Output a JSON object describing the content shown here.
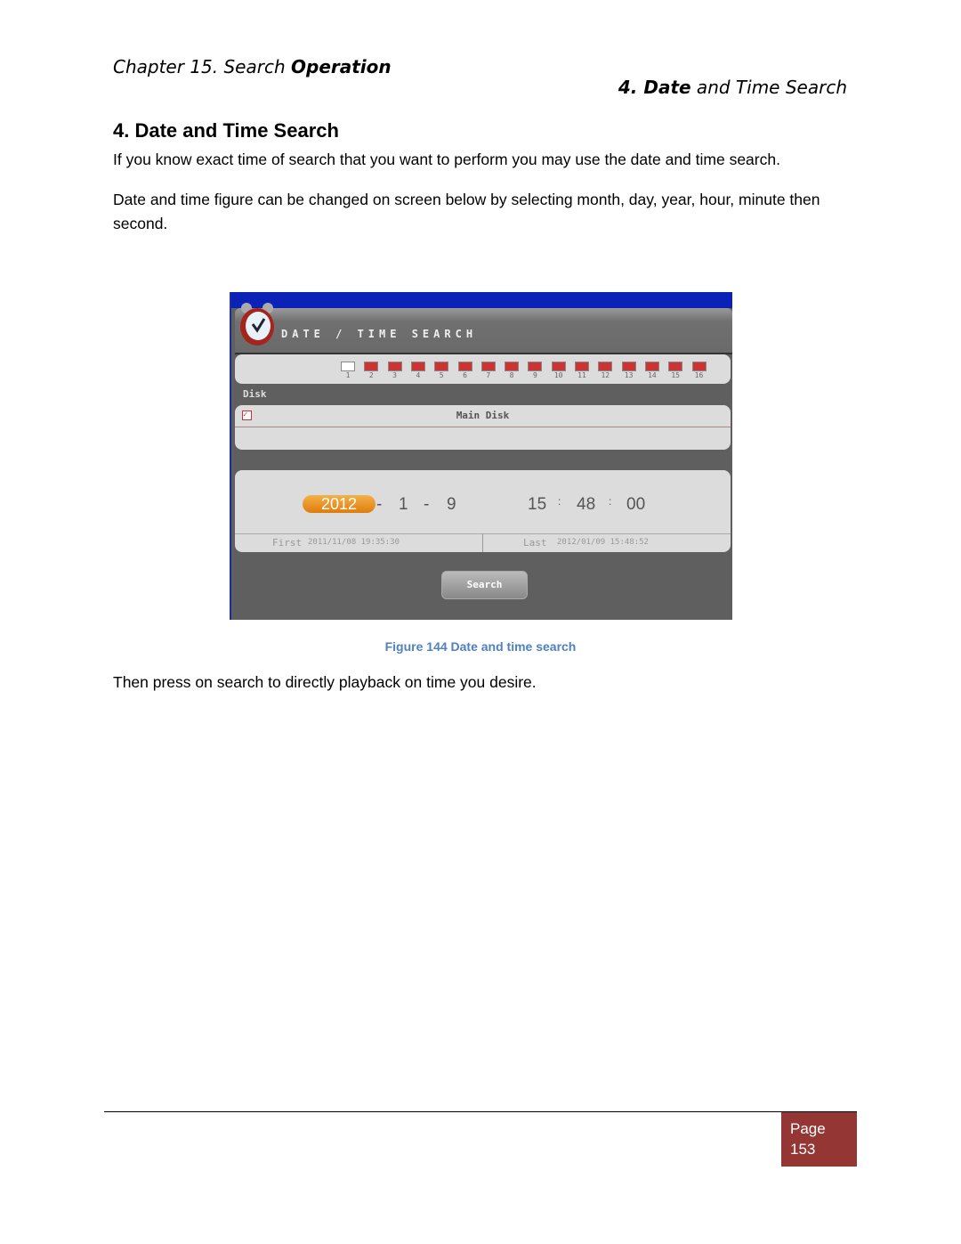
{
  "header": {
    "chapter_prefix": "Chapter 15. Search ",
    "chapter_bold": "Operation",
    "section_bold": "4. Date",
    "section_rest": " and Time Search"
  },
  "heading": "4. Date and Time Search",
  "paragraphs": [
    "If you know exact time of search that you want to perform you may use the date and time search.",
    "Date and time figure can be changed on screen below by selecting month, day, year, hour, minute then second.",
    "Then press on search to directly playback on time you desire."
  ],
  "figure": {
    "title": "DATE / TIME SEARCH",
    "channels": [
      "1",
      "2",
      "3",
      "4",
      "5",
      "6",
      "7",
      "8",
      "9",
      "10",
      "11",
      "12",
      "13",
      "14",
      "15",
      "16"
    ],
    "disk_label": "Disk",
    "disk_name": "Main Disk",
    "year": "2012",
    "month": "1",
    "day": "9",
    "hour": "15",
    "minute": "48",
    "second": "00",
    "first_label": "First",
    "first_value": "2011/11/08 19:35:30",
    "last_label": "Last",
    "last_value": "2012/01/09 15:48:52",
    "search_label": "Search",
    "accent": "#e58a1a"
  },
  "caption": "Figure 144 Date and time search",
  "footer": {
    "page_label": "Page",
    "page_number": "153",
    "color": "#943634"
  }
}
